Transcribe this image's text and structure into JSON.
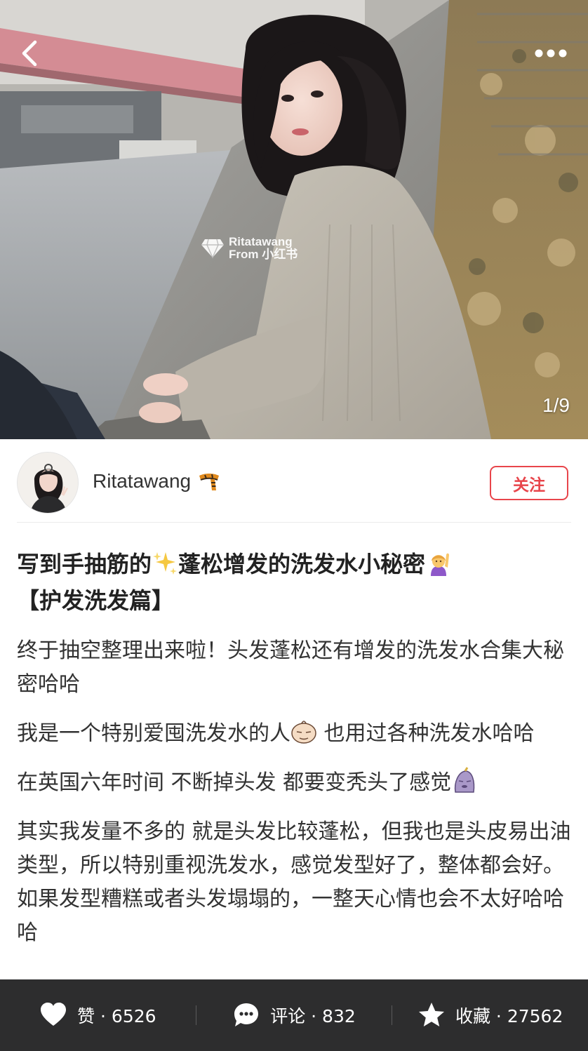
{
  "colors": {
    "accent": "#e8454b",
    "bottom_bar": "#2d2d2e",
    "text": "#333333"
  },
  "header": {
    "back_icon": "chevron-left-icon",
    "more_icon": "more-dots-icon",
    "pager": "1/9",
    "watermark_line1": "Ritatawang",
    "watermark_line2": "From 小红书"
  },
  "author": {
    "name": "Ritatawang",
    "badge_icon": "scarf-icon",
    "follow_label": "关注"
  },
  "post": {
    "title_part1": "写到手抽筋的",
    "title_part2": "蓬松增发的洗发水小秘密",
    "title_part3": "【护发洗发篇】",
    "p1": "终于抽空整理出来啦！头发蓬松还有增发的洗发水合集大秘密哈哈",
    "p2_part1": "我是一个特别爱囤洗发水的人",
    "p2_part2": " 也用过各种洗发水哈哈",
    "p3": "在英国六年时间 不断掉头发 都要变秃头了感觉",
    "p4": "其实我发量不多的 就是头发比较蓬松，但我也是头皮易出油类型，所以特别重视洗发水，感觉发型好了，整体都会好。如果发型糟糕或者头发塌塌的，一整天心情也会不太好哈哈哈"
  },
  "bottom_bar": {
    "like_label": "赞 · 6526",
    "comment_label": "评论 · 832",
    "collect_label": "收藏 · 27562"
  }
}
